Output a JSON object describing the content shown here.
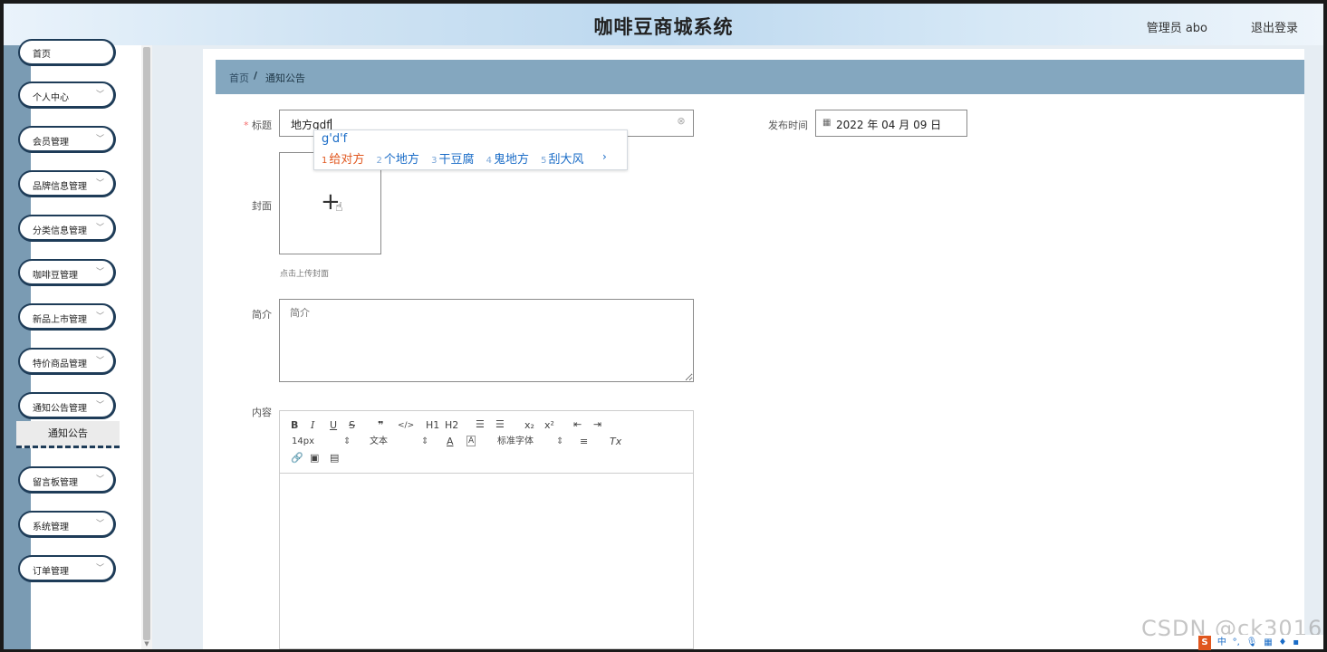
{
  "header": {
    "title": "咖啡豆商城系统",
    "user": "管理员 abo",
    "logout": "退出登录"
  },
  "sidebar": {
    "items": [
      {
        "label": "首页"
      },
      {
        "label": "个人中心"
      },
      {
        "label": "会员管理"
      },
      {
        "label": "品牌信息管理"
      },
      {
        "label": "分类信息管理"
      },
      {
        "label": "咖啡豆管理"
      },
      {
        "label": "新品上市管理"
      },
      {
        "label": "特价商品管理"
      },
      {
        "label": "通知公告管理"
      },
      {
        "label": "留言板管理"
      },
      {
        "label": "系统管理"
      },
      {
        "label": "订单管理"
      }
    ],
    "active_sub": "通知公告",
    "chevron": "chevron-down-icon"
  },
  "breadcrumb": {
    "home": "首页",
    "separator": "/",
    "current": "通知公告"
  },
  "form": {
    "title_label": "标题",
    "required_mark": "*",
    "title_value": "地方gdf",
    "publish_label": "发布时间",
    "publish_value": "2022 年 04 月 09 日",
    "cover_label": "封面",
    "cover_hint": "点击上传封面",
    "intro_label": "简介",
    "intro_placeholder": "简介",
    "content_label": "内容"
  },
  "ime": {
    "pinyin": "g'd'f",
    "candidates": [
      {
        "n": "1",
        "text": "给对方"
      },
      {
        "n": "2",
        "text": "个地方"
      },
      {
        "n": "3",
        "text": "干豆腐"
      },
      {
        "n": "4",
        "text": "鬼地方"
      },
      {
        "n": "5",
        "text": "刮大风"
      }
    ],
    "next": "›"
  },
  "editor": {
    "bold": "B",
    "italic": "I",
    "underline": "U",
    "strike": "S",
    "quote": "❞",
    "code": "</>",
    "h1": "H1",
    "h2": "H2",
    "sub": "x₂",
    "sup": "x²",
    "size": "14px",
    "header_sel": "文本",
    "font_sel": "标准字体",
    "color": "A",
    "bg": "A",
    "clean": "Tx"
  },
  "watermark": "CSDN @ck3016",
  "colors": {
    "sidebar_dark": "#1e3c58",
    "breadcrumb_bg": "#84a7bf",
    "ime_active": "#e0561e",
    "ime_blue": "#1a6cc7"
  }
}
